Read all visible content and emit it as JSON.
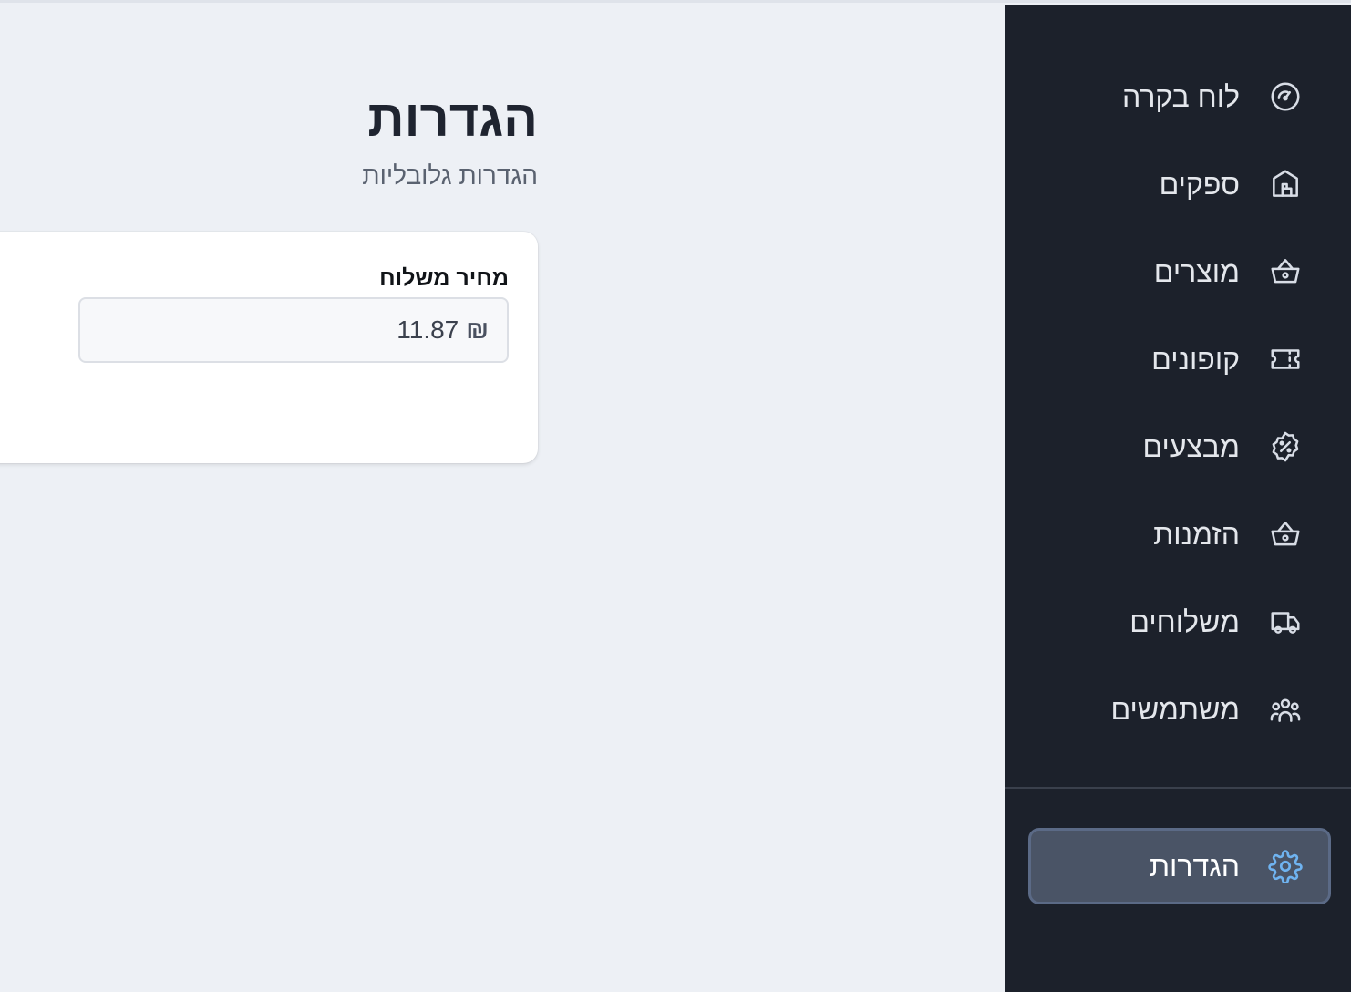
{
  "sidebar": {
    "items": [
      {
        "label": "לוח בקרה",
        "icon": "gauge-icon"
      },
      {
        "label": "ספקים",
        "icon": "store-icon"
      },
      {
        "label": "מוצרים",
        "icon": "basket-icon"
      },
      {
        "label": "קופונים",
        "icon": "ticket-icon"
      },
      {
        "label": "מבצעים",
        "icon": "discount-badge-icon"
      },
      {
        "label": "הזמנות",
        "icon": "basket-icon"
      },
      {
        "label": "משלוחים",
        "icon": "truck-icon"
      },
      {
        "label": "משתמשים",
        "icon": "users-icon"
      }
    ],
    "settings": {
      "label": "הגדרות",
      "icon": "gear-icon",
      "active": true
    }
  },
  "main": {
    "title": "הגדרות",
    "subtitle": "הגדרות גלובליות",
    "shipping": {
      "label": "מחיר משלוח",
      "currency": "₪",
      "value": "11.87"
    }
  },
  "colors": {
    "sidebar_bg": "#1c212b",
    "active_bg": "#4a5466",
    "active_icon": "#6fb3f0",
    "page_bg": "#edf0f5"
  }
}
